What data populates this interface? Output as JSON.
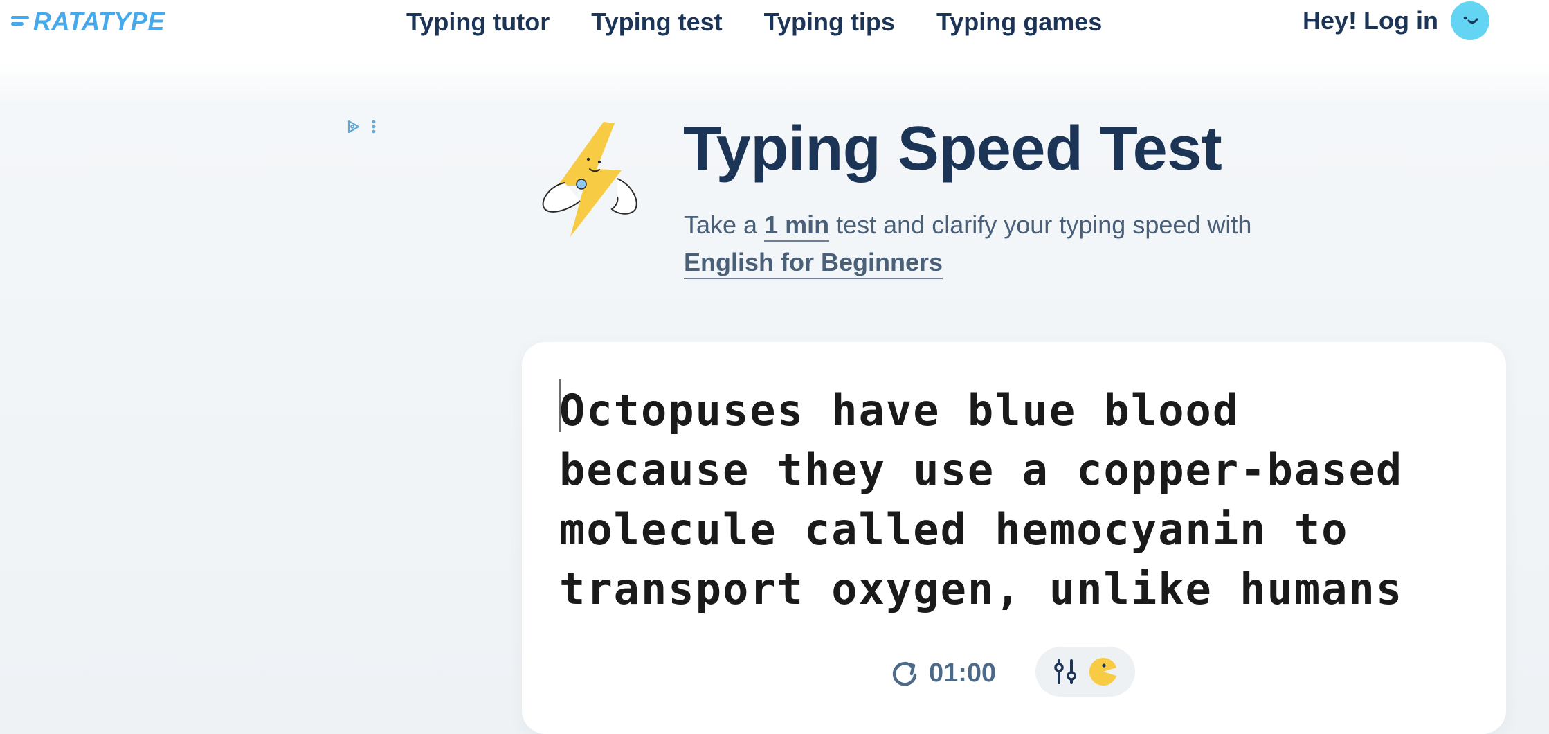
{
  "brand": {
    "name": "RATATYPE",
    "color": "#45a9ec"
  },
  "nav": {
    "items": [
      {
        "label": "Typing tutor"
      },
      {
        "label": "Typing test"
      },
      {
        "label": "Typing tips"
      },
      {
        "label": "Typing games"
      }
    ]
  },
  "account": {
    "login_label": "Hey! Log in",
    "avatar_color": "#63d4f2"
  },
  "ad": {
    "icons": [
      "adchoices-icon",
      "more-vertical-icon"
    ]
  },
  "hero": {
    "mascot_icon": "lightning-mascot-icon",
    "title": "Typing Speed Test",
    "subtitle_before": "Take a ",
    "duration": "1 min",
    "subtitle_after": " test and clarify your typing speed with",
    "course": "English for Beginners"
  },
  "test": {
    "text_lines": [
      "Octopuses have blue blood",
      "because they use a copper-based",
      "molecule called hemocyanin to",
      "transport oxygen, unlike humans"
    ],
    "timer": "01:00",
    "restart_icon": "restart-icon",
    "settings_icon": "sliders-icon",
    "mode_icon": "pacman-icon"
  },
  "colors": {
    "text_dark": "#1c3557",
    "subtitle": "#4a5f78",
    "timer": "#4d6a89",
    "mascot_yellow": "#f8cb45"
  }
}
